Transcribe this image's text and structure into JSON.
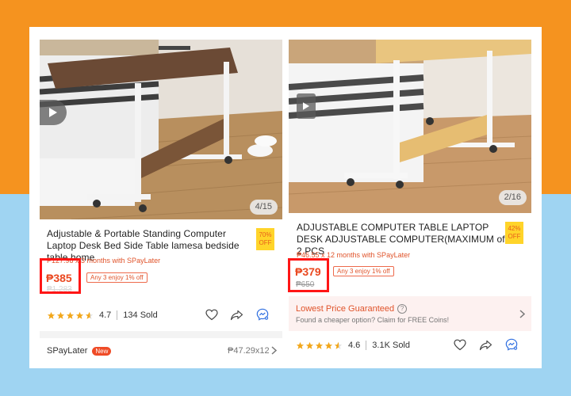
{
  "products": [
    {
      "media_counter": "4/15",
      "title": "Adjustable & Portable Standing Computer Laptop Desk Bed Side Table lamesa bedside table home",
      "off_percent": "70%",
      "off_label": "OFF",
      "installment": "₱127.98 x 3 months with SPayLater",
      "price": "₱385",
      "promo_tag": "Any 3 enjoy 1% off",
      "old_price": "₱1,283",
      "rating": "4.7",
      "sold": "134 Sold",
      "spaylater": {
        "label": "SPayLater",
        "badge": "New",
        "amount": "₱47.29x12"
      }
    },
    {
      "media_counter": "2/16",
      "title": "ADJUSTABLE COMPUTER TABLE LAPTOP DESK ADJUSTABLE COMPUTER(MAXIMUM of 2 PCS",
      "off_percent": "42%",
      "off_label": "OFF",
      "installment": "₱46.55 x 12 months with SPayLater",
      "price": "₱379",
      "promo_tag": "Any 3 enjoy 1% off",
      "old_price": "₱650",
      "lowest_price": {
        "title": "Lowest Price Guaranteed",
        "subtitle": "Found a cheaper option? Claim for FREE Coins!"
      },
      "rating": "4.6",
      "sold": "3.1K Sold"
    }
  ],
  "colors": {
    "accent": "#ea4820",
    "highlight_box": "#ff1616",
    "star": "#f2a71b",
    "messenger": "#2f6fe0"
  }
}
